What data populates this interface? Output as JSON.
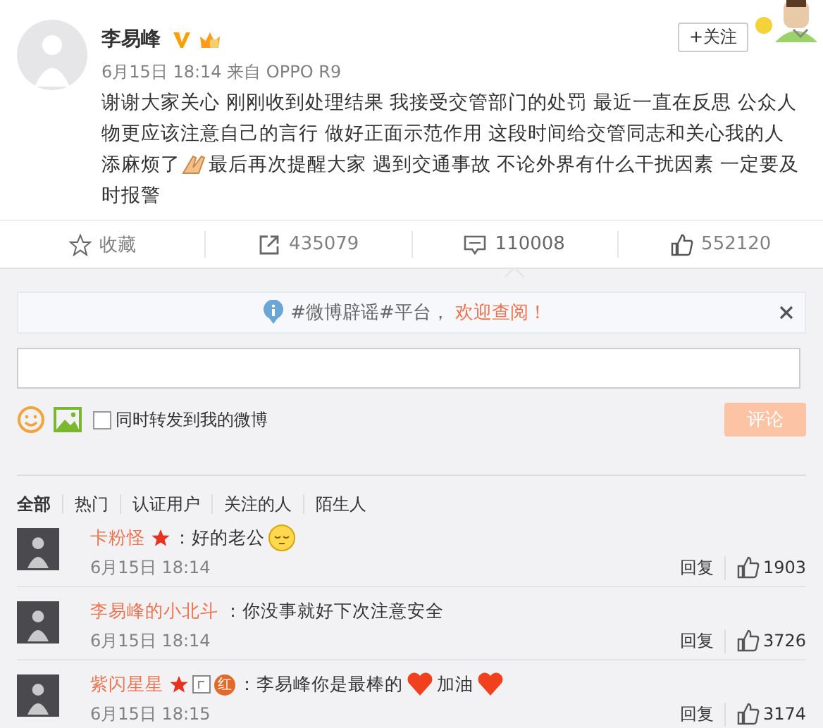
{
  "post": {
    "author": "李易峰",
    "badges": [
      {
        "kind": "verified"
      },
      {
        "kind": "crown"
      }
    ],
    "meta": "6月15日 18:14 来自 OPPO R9",
    "follow": "+关注",
    "lines": [
      [
        {
          "kind": "text",
          "text": "谢谢大家关心 刚刚收到处理结果 我接受交管部门的处罚 最近一直在反思 公众人物更应该注意自己的言行 做好正面示范作用 这段时间给交管同志和关心我的人"
        }
      ],
      [
        {
          "kind": "text",
          "text": "添麻烦了"
        },
        {
          "kind": "hands"
        },
        {
          "kind": "text",
          "text": "最后再次提醒大家 遇到交通事故 不论外界有什么干扰因素 一定要及"
        }
      ],
      [
        {
          "kind": "text",
          "text": "时报警"
        }
      ]
    ]
  },
  "actions": [
    {
      "kind": "favorite",
      "label": "收藏",
      "selected": false
    },
    {
      "kind": "repost",
      "label": "435079",
      "selected": false
    },
    {
      "kind": "comment",
      "label": "110008",
      "selected": true
    },
    {
      "kind": "like",
      "label": "552120",
      "selected": false
    }
  ],
  "notice": {
    "text": "#微博辟谣#平台，",
    "link": "欢迎查阅！"
  },
  "composer": {
    "repost_label": "同时转发到我的微博",
    "repost_checked": false,
    "submit": "评论"
  },
  "filters": [
    {
      "label": "全部",
      "selected": true
    },
    {
      "label": "热门",
      "selected": false
    },
    {
      "label": "认证用户",
      "selected": false
    },
    {
      "label": "关注的人",
      "selected": false
    },
    {
      "label": "陌生人",
      "selected": false
    }
  ],
  "comments": [
    {
      "name": "卡粉怪",
      "badges": [
        {
          "kind": "star"
        }
      ],
      "content": [
        {
          "kind": "text",
          "text": "：好的老公"
        },
        {
          "kind": "smiley"
        }
      ],
      "time": "6月15日 18:14",
      "reply": "回复",
      "likes": "1903"
    },
    {
      "name": "李易峰的小北斗",
      "content": [
        {
          "kind": "text",
          "text": "：你没事就好下次注意安全"
        }
      ],
      "time": "6月15日 18:14",
      "reply": "回复",
      "likes": "3726"
    },
    {
      "name": "紫闪星星",
      "badges": [
        {
          "kind": "star"
        },
        {
          "kind": "square"
        },
        {
          "kind": "circle",
          "text": "红"
        }
      ],
      "content": [
        {
          "kind": "text",
          "text": "：李易峰你是最棒的"
        },
        {
          "kind": "heart"
        },
        {
          "kind": "text",
          "text": "加油"
        },
        {
          "kind": "heart"
        }
      ],
      "time": "6月15日 18:15",
      "reply": "回复",
      "likes": "3174"
    }
  ]
}
